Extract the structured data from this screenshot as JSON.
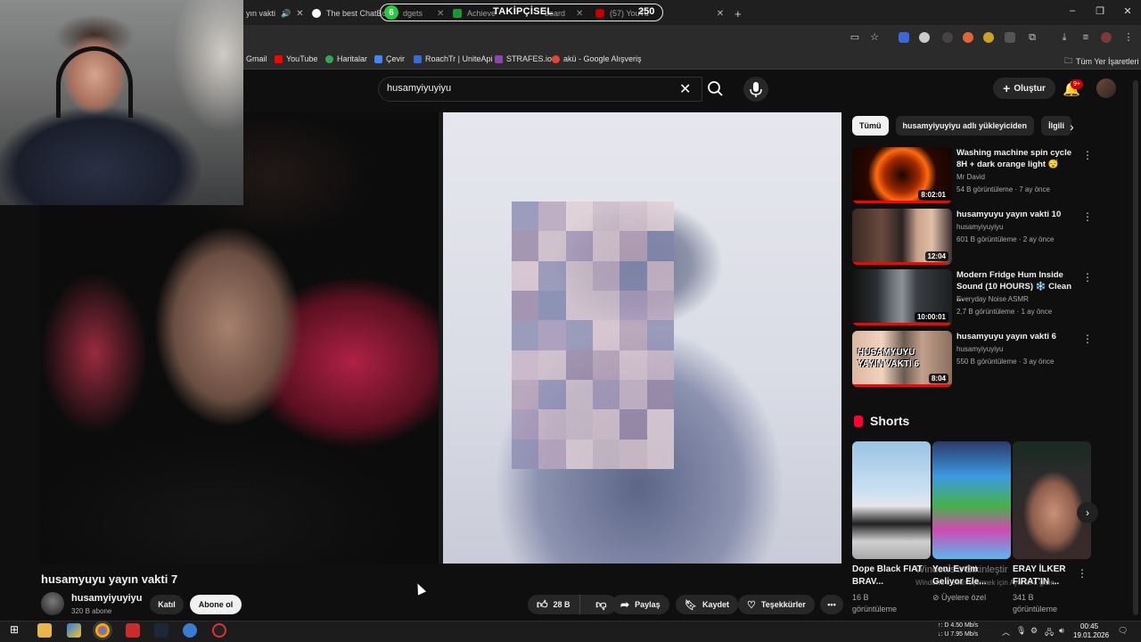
{
  "browser": {
    "tabs": [
      {
        "label": "yın vakti",
        "partial": true
      },
      {
        "label": "The best ChatBot"
      },
      {
        "label": "dgets"
      },
      {
        "label": "Achieve"
      },
      {
        "label": "board"
      },
      {
        "label": "(57) YouTu"
      }
    ],
    "new_tab": "+",
    "window_controls": [
      "–",
      "❐",
      "✕"
    ]
  },
  "stream_overlay": {
    "count": "6",
    "title": "TAKİPÇİSEL",
    "number": "250"
  },
  "bookmarks": [
    {
      "label": "Gmail",
      "color": "#d93025"
    },
    {
      "label": "YouTube",
      "color": "#ff0000"
    },
    {
      "label": "Haritalar",
      "color": "#34a853"
    },
    {
      "label": "Çevir",
      "color": "#4285f4"
    },
    {
      "label": "RoachTr | UniteApi",
      "color": "#3b6ad6"
    },
    {
      "label": "STRAFES.io",
      "color": "#8e44ad"
    },
    {
      "label": "akü - Google Alışveriş",
      "color": "#ea4335"
    }
  ],
  "bookmarks_all": "Tüm Yer İşaretleri",
  "youtube": {
    "search_query": "husamyiyuyiyu",
    "create_label": "Oluştur",
    "notification_count": "9+"
  },
  "video": {
    "title": "husamyuyu yayın vakti 7",
    "channel_name": "husamyiyuyiyu",
    "subscribers": "320 B abone",
    "join_label": "Katıl",
    "subscribe_label": "Abone ol",
    "likes": "28 B",
    "share_label": "Paylaş",
    "save_label": "Kaydet",
    "thanks_label": "Teşekkürler",
    "more_label": "•••"
  },
  "sidebar": {
    "chips": [
      "Tümü",
      "husamyiyuyiyu adlı yükleyiciden",
      "İlgili"
    ],
    "recommendations": [
      {
        "title": "Washing machine spin cycle 8H + dark orange light 😴",
        "channel": "Mr David",
        "meta": "54 B görüntüleme · 7 ay önce",
        "duration": "8:02:01",
        "progress": 1.0
      },
      {
        "title": "husamyuyu yayın vakti 10",
        "channel": "husamyiyuyiyu",
        "meta": "601 B görüntüleme · 2 ay önce",
        "duration": "12:04",
        "progress": 0.95
      },
      {
        "title": "Modern Fridge Hum Inside Sound (10 HOURS) ❄️ Clean ...",
        "channel": "Everyday Noise ASMR",
        "meta": "2,7 B görüntüleme · 1 ay önce",
        "duration": "10:00:01",
        "progress": 1.0
      },
      {
        "title": "husamyuyu yayın vakti 6",
        "channel": "husamyiyuyiyu",
        "meta": "550 B görüntüleme · 3 ay önce",
        "duration": "8:04",
        "thumb_text": "HUSAMYUYU YAYIN VAKTİ 6",
        "progress": 1.0
      }
    ],
    "shorts_title": "Shorts",
    "shorts": [
      {
        "title": "Dope Black FIAT BRAV...",
        "meta1": "16 B",
        "meta2": "görüntüleme"
      },
      {
        "title": "Yeni Evrim Geliyor Ele...",
        "meta1": "⊘ Üyelere özel",
        "meta2": ""
      },
      {
        "title": "ERAY İLKER FIRAT'IN ...",
        "meta1": "341 B",
        "meta2": "görüntüleme"
      }
    ]
  },
  "windows_watermark": {
    "line1": "Windows'u Etkinleştir",
    "line2": "Windows'u etkinleştirmek için Ayarlar'a gidin."
  },
  "taskbar": {
    "net_up": "↑: D  4.50 Mb/s",
    "net_down": "↓: U  7.95 Mb/s",
    "time": "00:45",
    "date": "19.01.2026"
  }
}
